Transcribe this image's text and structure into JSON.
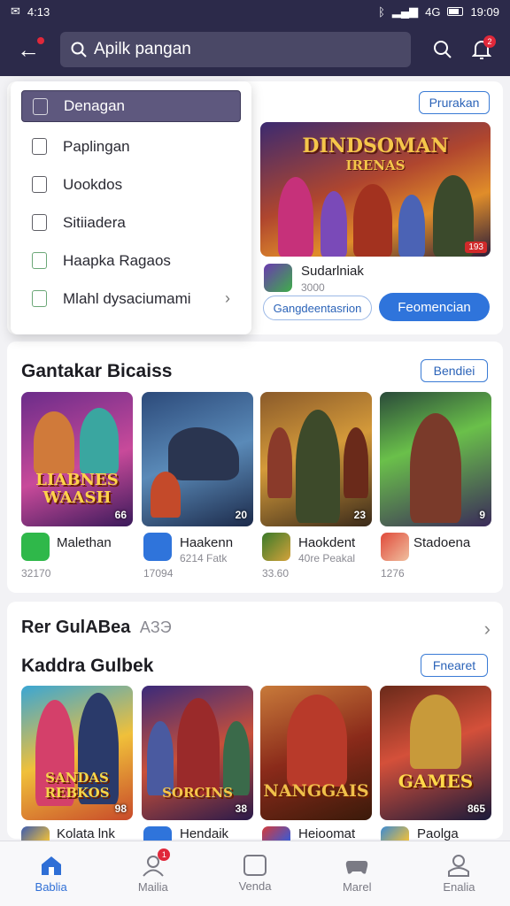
{
  "status_bar": {
    "left": "4:13",
    "right_time": "19:09",
    "signal_text": "4G"
  },
  "search": {
    "value": "Apilk pangan",
    "placeholder": ""
  },
  "header": {
    "notification_count": "2"
  },
  "dropdown": {
    "items": [
      {
        "label": "Denagan",
        "selected": true
      },
      {
        "label": "Paplingan"
      },
      {
        "label": "Uookdos"
      },
      {
        "label": "Sitiiadera"
      },
      {
        "label": "Haapka Ragaos"
      },
      {
        "label": "Mlahl dysaciumami",
        "has_arrow": true
      }
    ]
  },
  "featured": {
    "top_button": "Prurakan",
    "banner_title": "DINDSOMAN",
    "banner_subtitle": "IRENAS",
    "banner_rating": "193",
    "app_name": "Sudarlniak",
    "app_sub": "3000",
    "outline_button": "Gangdeentasrion",
    "solid_button": "Feomencian"
  },
  "section1": {
    "title": "Gantakar Bicaiss",
    "button": "Bendiei",
    "games": [
      {
        "tile_title": "LIABNES WAASH",
        "num": "66",
        "name": "Malethan",
        "sub": "32170"
      },
      {
        "tile_title": "",
        "num": "20",
        "name": "Haakenn",
        "sub": "6214 Fatk"
      },
      {
        "tile_title": "",
        "num": "23",
        "name": "Haokdent",
        "sub": "40re Peakal"
      },
      {
        "tile_title": "",
        "num": "9",
        "name": "Stadoena",
        "sub": "1276"
      }
    ],
    "sub1_extra": "17094",
    "sub3_extra": "33.60"
  },
  "section2": {
    "row_label": "Rer GulABea",
    "row_label_extra": "AЗЭ",
    "title": "Kaddra Gulbek",
    "button": "Fnearet",
    "games": [
      {
        "tile_title": "SANDAS REBKOS",
        "num": "98",
        "name": "Kolata lnk"
      },
      {
        "tile_title": "SORCINS",
        "num": "38",
        "name": "Hendaik"
      },
      {
        "tile_title": "NANGGAIS",
        "num": "",
        "name": "Heioomat"
      },
      {
        "tile_title": "GAMES",
        "num": "865",
        "name": "Paolga"
      }
    ]
  },
  "bottom_nav": [
    {
      "label": "Bablia",
      "active": true
    },
    {
      "label": "Mailia",
      "badge": "1"
    },
    {
      "label": "Venda"
    },
    {
      "label": "Marel"
    },
    {
      "label": "Enalia"
    }
  ],
  "colors": {
    "header": "#2c2a4a",
    "accent": "#2f74db",
    "badge": "#e0283a"
  }
}
